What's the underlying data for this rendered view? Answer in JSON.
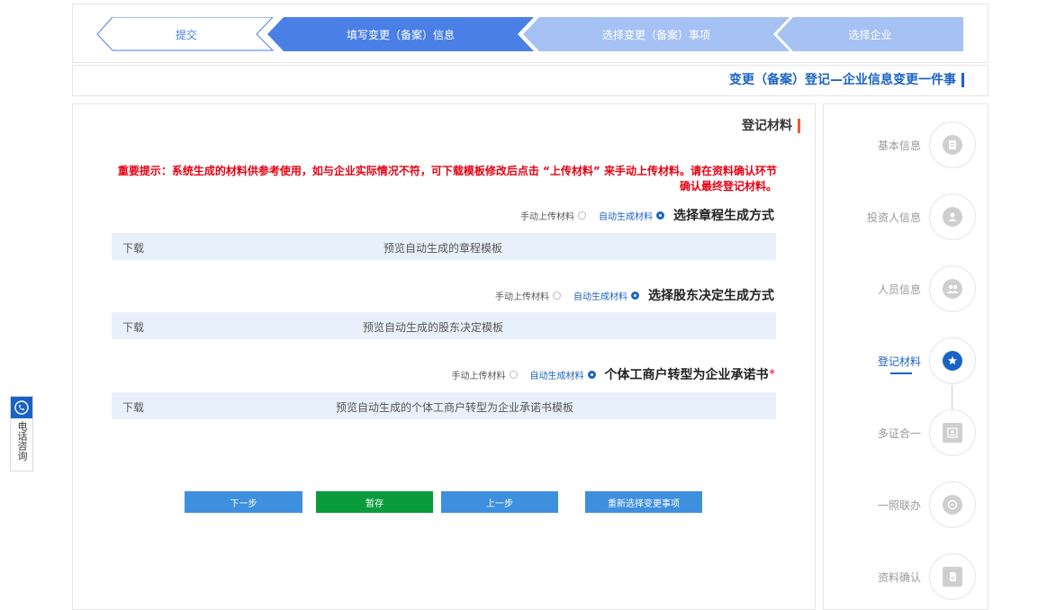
{
  "steps": [
    {
      "label": "提交",
      "state": "outline"
    },
    {
      "label": "填写变更（备案）信息",
      "state": "active"
    },
    {
      "label": "选择变更（备案）事项",
      "state": "done"
    },
    {
      "label": "选择企业",
      "state": "done"
    }
  ],
  "page_title": "变更（备案）登记—企业信息变更一件事",
  "section_title": "登记材料",
  "notice": "重要提示：系统生成的材料供参考使用，如与企业实际情况不符，可下载模板修改后点击 “上传材料” 来手动上传材料。请在资料确认环节确认最终登记材料。",
  "choices": [
    {
      "label": "选择章程生成方式",
      "required": "",
      "auto": "自动生成材料",
      "manual": "手动上传材料",
      "download": "下载",
      "preview": "预览自动生成的章程模板"
    },
    {
      "label": "选择股东决定生成方式",
      "required": "",
      "auto": "自动生成材料",
      "manual": "手动上传材料",
      "download": "下载",
      "preview": "预览自动生成的股东决定模板"
    },
    {
      "label": "个体工商户转型为企业承诺书",
      "required": "*",
      "auto": "自动生成材料",
      "manual": "手动上传材料",
      "download": "下载",
      "preview": "预览自动生成的个体工商户转型为企业承诺书模板"
    }
  ],
  "buttons": {
    "next": "下一步",
    "save": "暂存",
    "prev": "上一步",
    "reselect": "重新选择变更事项"
  },
  "phone_label": "电话咨询",
  "nav": [
    {
      "label": "基本信息",
      "icon": "document-icon",
      "active": false
    },
    {
      "label": "投资人信息",
      "icon": "investor-icon",
      "active": false
    },
    {
      "label": "人员信息",
      "icon": "people-icon",
      "active": false
    },
    {
      "label": "登记材料",
      "icon": "badge-star-icon",
      "active": true
    },
    {
      "label": "多证合一",
      "icon": "certificate-icon",
      "active": false
    },
    {
      "label": "一照联办",
      "icon": "link-icon",
      "active": false
    },
    {
      "label": "资料确认",
      "icon": "confirm-doc-icon",
      "active": false
    }
  ],
  "colors": {
    "primary": "#1a63c4",
    "step_active": "#4a80e6",
    "step_done": "#a6c1f3",
    "notice": "#e60012",
    "save": "#0a9b3c"
  }
}
